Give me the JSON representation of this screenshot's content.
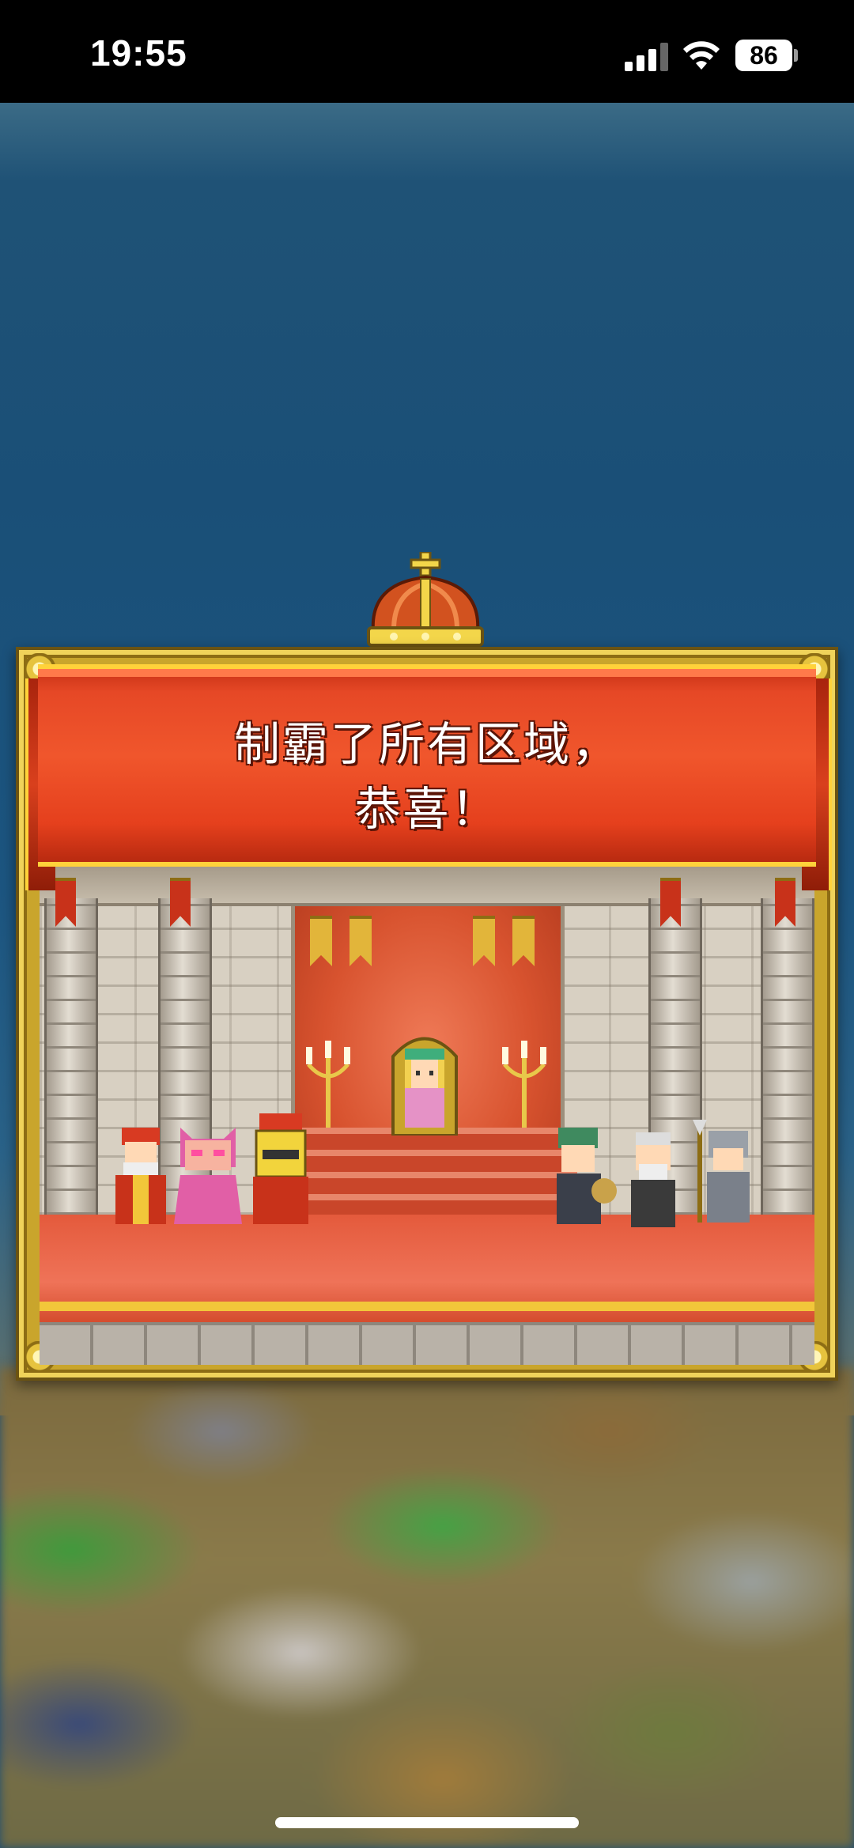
{
  "status_bar": {
    "time": "19:55",
    "battery": "86",
    "icons": [
      "cellular-signal-icon",
      "wifi-icon",
      "battery-icon"
    ]
  },
  "dialog": {
    "message_line1": "制霸了所有区域，",
    "message_line2": "恭喜！"
  },
  "scene": {
    "characters": [
      "king-character",
      "pink-cat-princess-character",
      "yellow-crowned-mascot-character",
      "queen-on-throne-character",
      "green-hat-merchant-character",
      "old-sage-character",
      "spear-knight-character"
    ]
  },
  "colors": {
    "banner_red": "#e64826",
    "frame_gold": "#c9a52c",
    "sky_blue": "#1c4f77"
  }
}
